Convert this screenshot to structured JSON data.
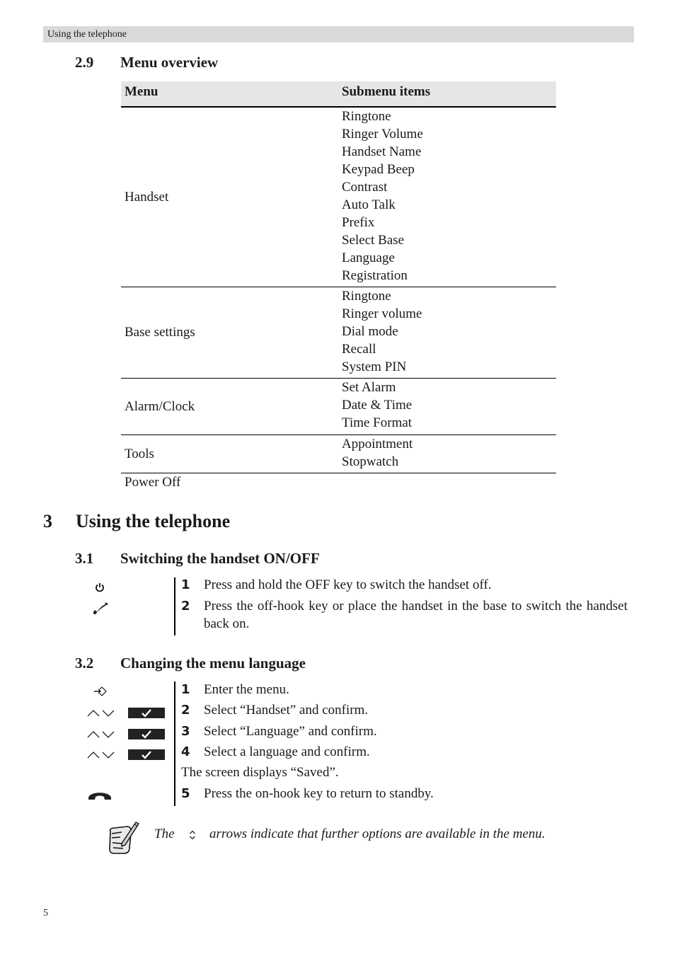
{
  "running_header": "Using the telephone",
  "section_2_9": {
    "number": "2.9",
    "title": "Menu overview"
  },
  "menu_table": {
    "headers": [
      "Menu",
      "Submenu items"
    ],
    "rows": [
      {
        "menu": "Handset",
        "items": [
          "Ringtone",
          "Ringer Volume",
          "Handset Name",
          "Keypad Beep",
          "Contrast",
          "Auto Talk",
          "Prefix",
          "Select Base",
          "Language",
          "Registration"
        ]
      },
      {
        "menu": "Base settings",
        "items": [
          "Ringtone",
          "Ringer volume",
          "Dial mode",
          "Recall",
          "System PIN"
        ]
      },
      {
        "menu": "Alarm/Clock",
        "items": [
          "Set Alarm",
          "Date & Time",
          "Time Format"
        ]
      },
      {
        "menu": "Tools",
        "items": [
          "Appointment",
          "Stopwatch"
        ]
      },
      {
        "menu": "Power Off",
        "items": []
      }
    ]
  },
  "chapter_3": {
    "number": "3",
    "title": "Using the telephone"
  },
  "section_3_1": {
    "number": "3.1",
    "title": "Switching the handset ON/OFF",
    "icons": [
      "power-icon",
      "off-hook-phone-icon"
    ],
    "steps": [
      {
        "n": "1",
        "text": "Press and hold the OFF key to switch the handset off."
      },
      {
        "n": "2",
        "text": "Press the off-hook key or place the handset in the base to switch the handset back on."
      }
    ]
  },
  "section_3_2": {
    "number": "3.2",
    "title": "Changing the menu language",
    "icons": [
      "menu-enter-icon",
      "up-down-arrows-icon",
      "ok-key-icon",
      "on-hook-phone-icon"
    ],
    "steps": [
      {
        "n": "1",
        "text": "Enter the menu."
      },
      {
        "n": "2",
        "text": "Select “Handset” and confirm."
      },
      {
        "n": "3",
        "text": "Select “Language” and confirm."
      },
      {
        "n": "4",
        "text": "Select a language and confirm."
      },
      {
        "n": "5",
        "text": "Press the on-hook key to return to standby."
      }
    ],
    "result_text": "The screen displays “Saved”."
  },
  "note": {
    "icon": "note-pencil-icon",
    "text_before": "The",
    "inline_icon": "scroll-arrows-icon",
    "text_after": "arrows indicate that further options are available in the menu."
  },
  "page_number": "5"
}
